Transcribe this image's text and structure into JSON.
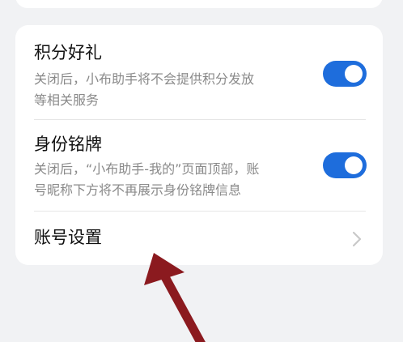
{
  "settings": {
    "points_gift": {
      "title": "积分好礼",
      "desc_line1": "关闭后，小布助手将不会提供积分发放",
      "desc_line2": "等相关服务",
      "enabled": true
    },
    "identity_badge": {
      "title": "身份铭牌",
      "desc_line1": "关闭后，“小布助手-我的”页面顶部，账",
      "desc_line2": "号昵称下方将不再展示身份铭牌信息",
      "enabled": true
    },
    "account_settings": {
      "title": "账号设置"
    }
  },
  "colors": {
    "toggle_on": "#1e6ddc",
    "annotation_arrow": "#8b1a1f"
  }
}
